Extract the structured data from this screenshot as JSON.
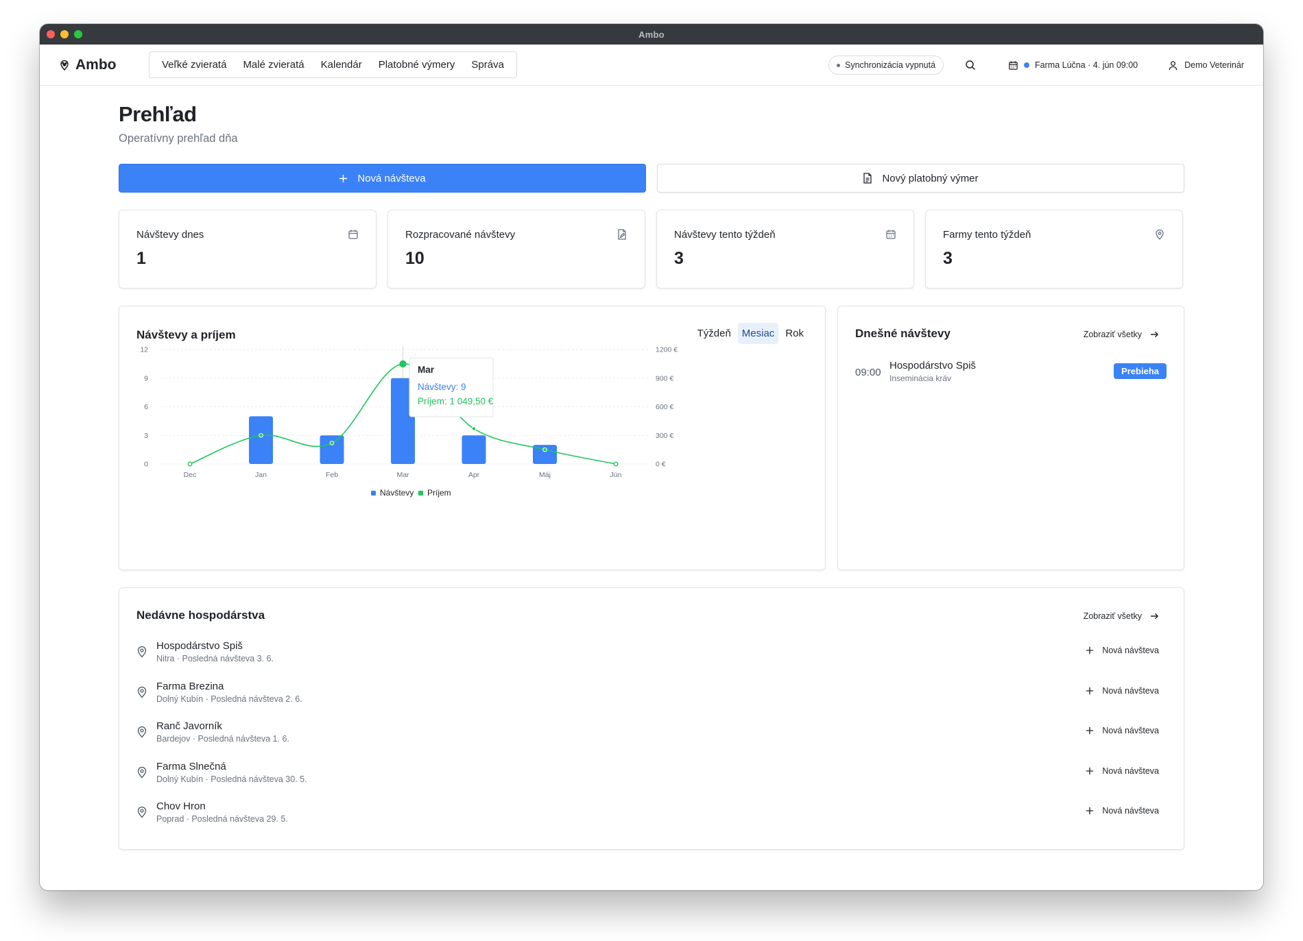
{
  "window": {
    "title": "Ambo"
  },
  "nav": {
    "brand": "Ambo",
    "items": [
      {
        "label": "Veľké zvieratá"
      },
      {
        "label": "Malé zvieratá"
      },
      {
        "label": "Kalendár"
      },
      {
        "label": "Platobné výmery"
      },
      {
        "label": "Správa"
      }
    ],
    "sync": "Synchronizácia vypnutá",
    "farm": "Farma Lúčna · 4. jún 09:00",
    "user": "Demo Veterinár"
  },
  "page": {
    "title": "Prehľad",
    "subtitle": "Operatívny prehľad dňa"
  },
  "actions": {
    "new_visit": "Nová návšteva",
    "new_payment": "Nový platobný výmer"
  },
  "stats": [
    {
      "label": "Návštevy dnes",
      "value": "1",
      "icon": "calendar-icon"
    },
    {
      "label": "Rozpracované návštevy",
      "value": "10",
      "icon": "file-pen-icon"
    },
    {
      "label": "Návštevy tento týždeň",
      "value": "3",
      "icon": "calendar-icon"
    },
    {
      "label": "Farmy tento týždeň",
      "value": "3",
      "icon": "map-pin-icon"
    }
  ],
  "chart_card": {
    "title": "Návštevy a príjem",
    "periods": [
      "Týždeň",
      "Mesiac",
      "Rok"
    ],
    "active_period": "Mesiac",
    "tooltip": {
      "title": "Mar",
      "visits": "Návštevy: 9",
      "revenue": "Príjem: 1 049,50 €"
    }
  },
  "chart_data": {
    "type": "bar",
    "categories": [
      "Dec",
      "Jan",
      "Feb",
      "Mar",
      "Apr",
      "Máj",
      "Jún"
    ],
    "series": [
      {
        "name": "Návštevy",
        "type": "bar",
        "axis": "left",
        "values": [
          0,
          5,
          3,
          9,
          3,
          2,
          0
        ],
        "color": "#3b82f6"
      },
      {
        "name": "Príjem",
        "type": "line",
        "axis": "right",
        "values": [
          0,
          300,
          220,
          1049.5,
          370,
          150,
          0
        ],
        "color": "#22c55e"
      }
    ],
    "y_left": {
      "ticks": [
        "0",
        "3",
        "6",
        "9",
        "12"
      ],
      "range": [
        0,
        12
      ]
    },
    "y_right": {
      "ticks": [
        "0 €",
        "300 €",
        "600 €",
        "900 €",
        "1200 €"
      ],
      "range": [
        0,
        1200
      ]
    },
    "highlight_index": 3,
    "legend": "bottom-center"
  },
  "today": {
    "title": "Dnešné návštevy",
    "show_all": "Zobraziť všetky",
    "visits": [
      {
        "time": "09:00",
        "farm": "Hospodárstvo Spiš",
        "desc": "Inseminácia kráv",
        "status": "Prebieha"
      }
    ]
  },
  "farms": {
    "title": "Nedávne hospodárstva",
    "show_all": "Zobraziť všetky",
    "action_label": "Nová návšteva",
    "items": [
      {
        "name": "Hospodárstvo Spiš",
        "meta": "Nitra · Posledná návšteva 3. 6."
      },
      {
        "name": "Farma Brezina",
        "meta": "Dolný Kubín · Posledná návšteva 2. 6."
      },
      {
        "name": "Ranč Javorník",
        "meta": "Bardejov · Posledná návšteva 1. 6."
      },
      {
        "name": "Farma Slnečná",
        "meta": "Dolný Kubín · Posledná návšteva 30. 5."
      },
      {
        "name": "Chov Hron",
        "meta": "Poprad · Posledná návšteva 29. 5."
      }
    ]
  }
}
